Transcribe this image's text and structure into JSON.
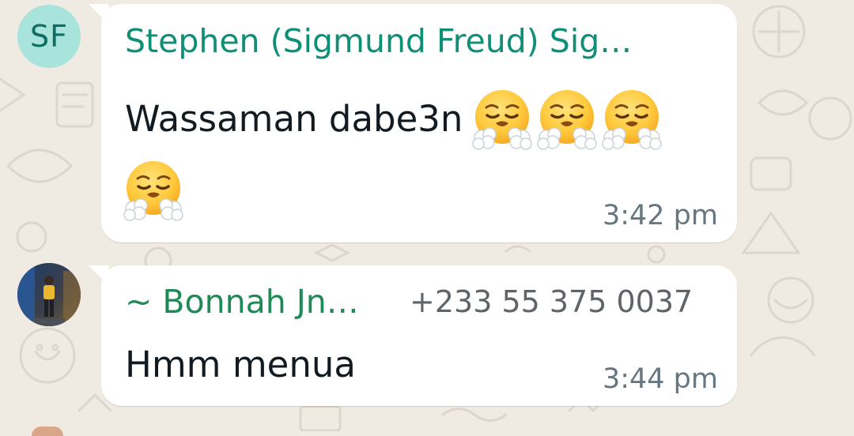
{
  "messages": [
    {
      "avatar": {
        "type": "initials",
        "initials": "SF",
        "bg": "#a8e3dc",
        "fg": "#0f6e63"
      },
      "sender": "Stephen (Sigmund Freud) Sig…",
      "sender_color": "#0e8f76",
      "text": "Wassaman dabe3n",
      "emoji": "face-with-steam-from-nose",
      "emoji_count": 4,
      "time": "3:42 pm"
    },
    {
      "avatar": {
        "type": "photo",
        "icon": "person-photo"
      },
      "sender": "~ Bonnah Jn…",
      "sender_color": "#1f8a57",
      "phone": "+233 55 375 0037",
      "text": "Hmm menua",
      "time": "3:44 pm"
    }
  ],
  "colors": {
    "chat_background": "#efeae2",
    "bubble": "#ffffff",
    "timestamp": "#667781",
    "message_text": "#111b21"
  }
}
